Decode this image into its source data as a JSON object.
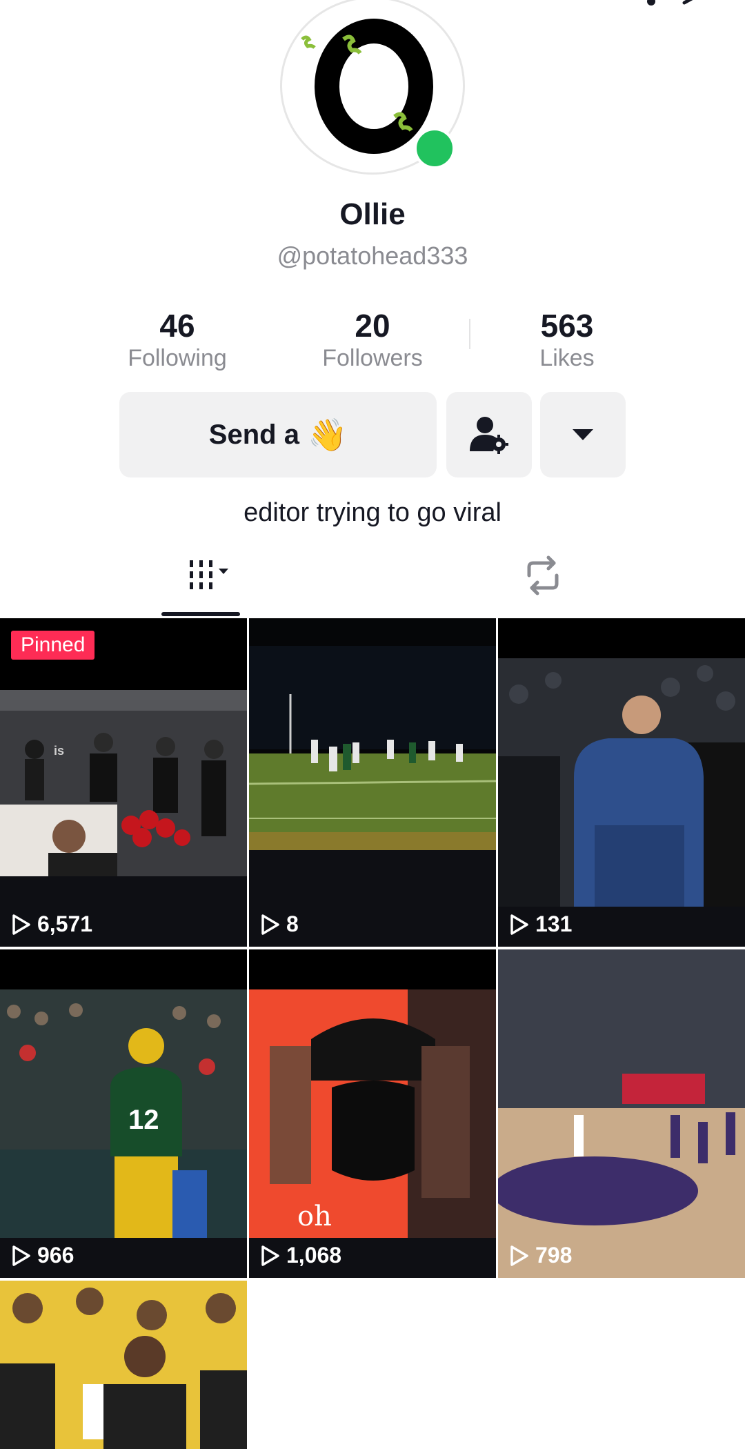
{
  "profile": {
    "name": "Ollie",
    "handle": "@potatohead333",
    "bio": "editor trying to go viral",
    "avatar_letter": "O",
    "online_color": "#21c25e"
  },
  "stats": [
    {
      "value": "46",
      "label": "Following"
    },
    {
      "value": "20",
      "label": "Followers"
    },
    {
      "value": "563",
      "label": "Likes"
    }
  ],
  "actions": {
    "send_label": "Send a",
    "send_emoji": "👋"
  },
  "tabs": [
    {
      "icon": "videos-grid-icon",
      "active": true
    },
    {
      "icon": "repost-icon",
      "active": false
    }
  ],
  "videos": [
    {
      "views": "6,571",
      "pinned": true,
      "pinned_label": "Pinned",
      "overlay_text": "is"
    },
    {
      "views": "8",
      "pinned": false
    },
    {
      "views": "131",
      "pinned": false
    },
    {
      "views": "966",
      "pinned": false,
      "overlay_text": "12"
    },
    {
      "views": "1,068",
      "pinned": false,
      "overlay_text": "oh"
    },
    {
      "views": "798",
      "pinned": false
    },
    {
      "views": "",
      "pinned": false
    }
  ],
  "colors": {
    "accent": "#fe2c55",
    "text": "#161823",
    "muted": "#8a8b91",
    "button_bg": "#f1f1f2"
  }
}
